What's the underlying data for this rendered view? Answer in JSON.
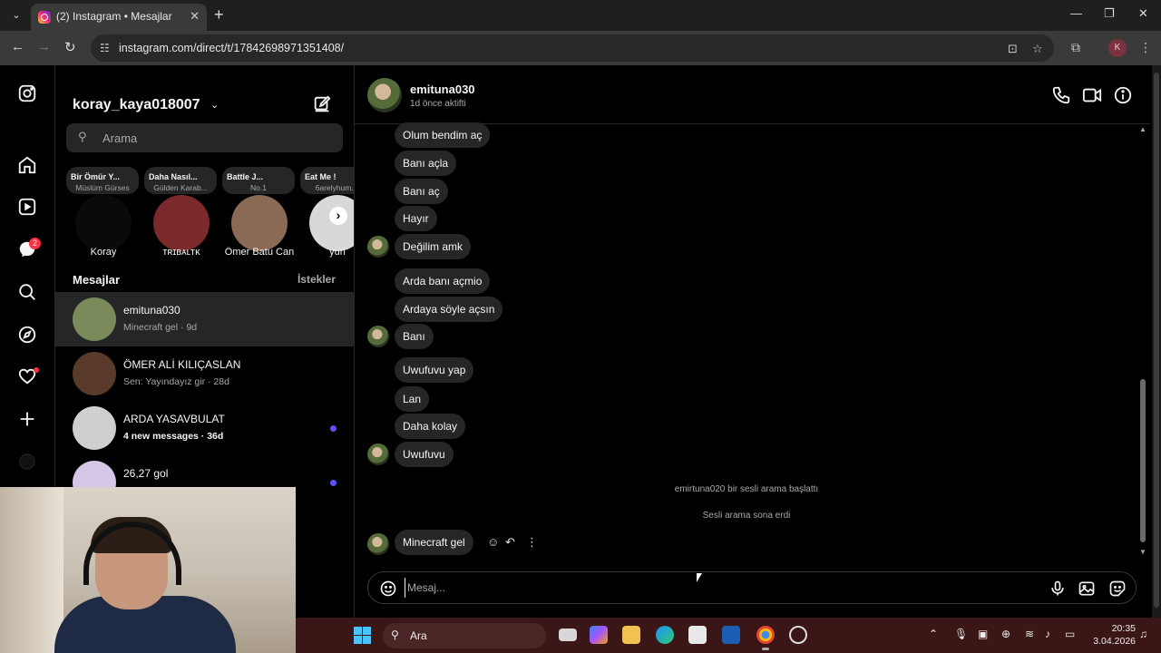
{
  "browser": {
    "tab_title": "(2) Instagram • Mesajlar",
    "url": "instagram.com/direct/t/17842698971351408/",
    "profile_letter": "K"
  },
  "sidebar": {
    "notifications_badge": "2"
  },
  "dm_list": {
    "account_name": "koray_kaya018007",
    "search_placeholder": "Arama",
    "notes": [
      {
        "line1": "Bir Ömür Y...",
        "line2": "Müslüm Gürses",
        "name": "Koray",
        "color": "#0a0a0a"
      },
      {
        "line1": "Daha Nasıl...",
        "line2": "Gülden Karab...",
        "name": "ᴛʀɪʙᴀʟᴛᴋ",
        "color": "#7a2a2a"
      },
      {
        "line1": "Battle J...",
        "line2": "No.1",
        "name": "Ömer Batu Can",
        "color": "#8a6a55"
      },
      {
        "line1": "Eat Me !",
        "line2": "6arelyhum...",
        "name": "yuri",
        "color": "#d8d8d8"
      }
    ],
    "messages_heading": "Mesajlar",
    "requests_label": "İstekler",
    "conversations": [
      {
        "name": "emituna030",
        "sub": "Minecraft gel · 9d",
        "unread": false,
        "color": "#7a8a5a"
      },
      {
        "name": "ÖMER ALİ KILIÇASLAN",
        "sub": "Sen: Yayındayız gir · 28d",
        "unread": false,
        "color": "#5a3a2a"
      },
      {
        "name": "ARDA YASAVBULAT",
        "sub": "4 new messages · 36d",
        "unread": true,
        "color": "#cfcfcf"
      },
      {
        "name": "26,27 gol",
        "sub": "",
        "unread": true,
        "color": "#d6c6e6"
      }
    ]
  },
  "chat": {
    "contact_name": "emituna030",
    "contact_status": "1d önce aktifti",
    "messages": [
      {
        "text": "Olum bendim aç",
        "avatar": false
      },
      {
        "text": "Banı açla",
        "avatar": false
      },
      {
        "text": "Banı aç",
        "avatar": false
      },
      {
        "text": "Hayır",
        "avatar": false
      },
      {
        "text": "Değilim amk",
        "avatar": true
      },
      {
        "text": "Arda banı açmio",
        "avatar": false
      },
      {
        "text": "Ardaya söyle açsın",
        "avatar": false
      },
      {
        "text": "Banı",
        "avatar": true
      },
      {
        "text": "Uwufuvu yap",
        "avatar": false
      },
      {
        "text": "Lan",
        "avatar": false
      },
      {
        "text": "Daha kolay",
        "avatar": false
      },
      {
        "text": "Uwufuvu",
        "avatar": true
      }
    ],
    "system_call_started": "emirtuna020 bir sesli arama başlattı",
    "system_call_ended": "Sesli arama sona erdi",
    "last_message": "Minecraft gel",
    "composer_placeholder": "Mesaj..."
  },
  "taskbar": {
    "search_label": "Ara",
    "time": "20:35",
    "date": "3.04.2026"
  }
}
